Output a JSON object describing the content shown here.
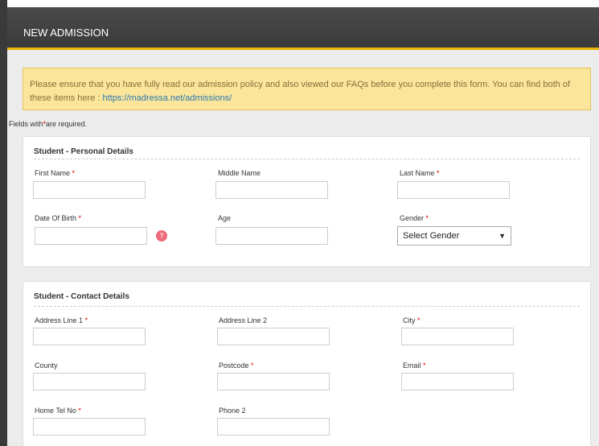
{
  "header": {
    "title": "NEW ADMISSION"
  },
  "notice": {
    "text": "Please ensure that you have fully read our admission policy and also viewed our FAQs before you complete this form. You can find both of these items here : ",
    "link": "https://madressa.net/admissions/"
  },
  "required_note": {
    "prefix": "Fields with",
    "star": "*",
    "suffix": "are required."
  },
  "personal": {
    "title": "Student - Personal Details",
    "first_name": "First Name",
    "middle_name": "Middle Name",
    "last_name": "Last Name",
    "dob": "Date Of Birth",
    "age": "Age",
    "gender": "Gender",
    "gender_value": "Select Gender",
    "help": "?"
  },
  "contact": {
    "title": "Student - Contact Details",
    "address1": "Address Line 1",
    "address2": "Address Line 2",
    "city": "City",
    "county": "County",
    "postcode": "Postcode",
    "email": "Email",
    "home_tel": "Home Tel No",
    "phone2": "Phone 2"
  },
  "star": "*",
  "colors": {
    "header_bg": "#3b3b3b",
    "accent": "#e8b400",
    "notice_bg": "#fbe59a",
    "link": "#2a7ab0",
    "required": "#dd0000",
    "help_icon": "#ee6a7b"
  },
  "icons": {
    "help": "help-icon",
    "dropdown": "chevron-down-icon"
  }
}
